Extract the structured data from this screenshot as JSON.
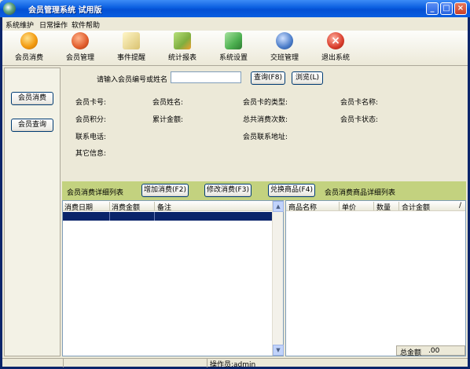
{
  "window": {
    "title": "会员管理系统 试用版"
  },
  "menu": [
    "系统维护",
    "日常操作",
    "软件帮助"
  ],
  "toolbar": [
    {
      "label": "会员消费",
      "icon": "play-circle-icon",
      "color": "#f39c12"
    },
    {
      "label": "会员管理",
      "icon": "members-icon",
      "color": "#e05b2b"
    },
    {
      "label": "事件提醒",
      "icon": "notepad-icon",
      "color": "#d9c270"
    },
    {
      "label": "统计报表",
      "icon": "chart-icon",
      "color": "#7fae3f"
    },
    {
      "label": "系统设置",
      "icon": "settings-icon",
      "color": "#4caf50"
    },
    {
      "label": "交班管理",
      "icon": "exchange-icon",
      "color": "#4a7cc9"
    },
    {
      "label": "退出系统",
      "icon": "exit-icon",
      "color": "#d93c2b"
    }
  ],
  "sidebar": {
    "consume": "会员消费",
    "query": "会员查询"
  },
  "search": {
    "label": "请输入会员编号或姓名",
    "value": "",
    "query_btn": "查询(F8)",
    "browse_btn": "浏览(L)"
  },
  "info": {
    "card_no": "会员卡号:",
    "name": "会员姓名:",
    "card_type": "会员卡的类型:",
    "card_name": "会员卡名称:",
    "points": "会员积分:",
    "total_amount": "累计金额:",
    "total_count": "总共消费次数:",
    "card_status": "会员卡状态:",
    "phone": "联系电话:",
    "address": "会员联系地址:",
    "other": "其它信息:"
  },
  "actions": {
    "left_title": "会员消费详细列表",
    "add": "增加消费(F2)",
    "edit": "修改消费(F3)",
    "redeem": "兑换商品(F4)",
    "right_title": "会员消费商品详细列表"
  },
  "left_grid": {
    "columns": [
      "消费日期",
      "消费金额",
      "备注"
    ]
  },
  "right_grid": {
    "columns": [
      "商品名称",
      "单价",
      "数量",
      "合计金额"
    ],
    "total_label": "总金额",
    "total_value": ".00"
  },
  "status": {
    "operator": "操作员:admin"
  },
  "colors": {
    "accent_bar": "#c3d27f",
    "selection": "#0a246a"
  }
}
